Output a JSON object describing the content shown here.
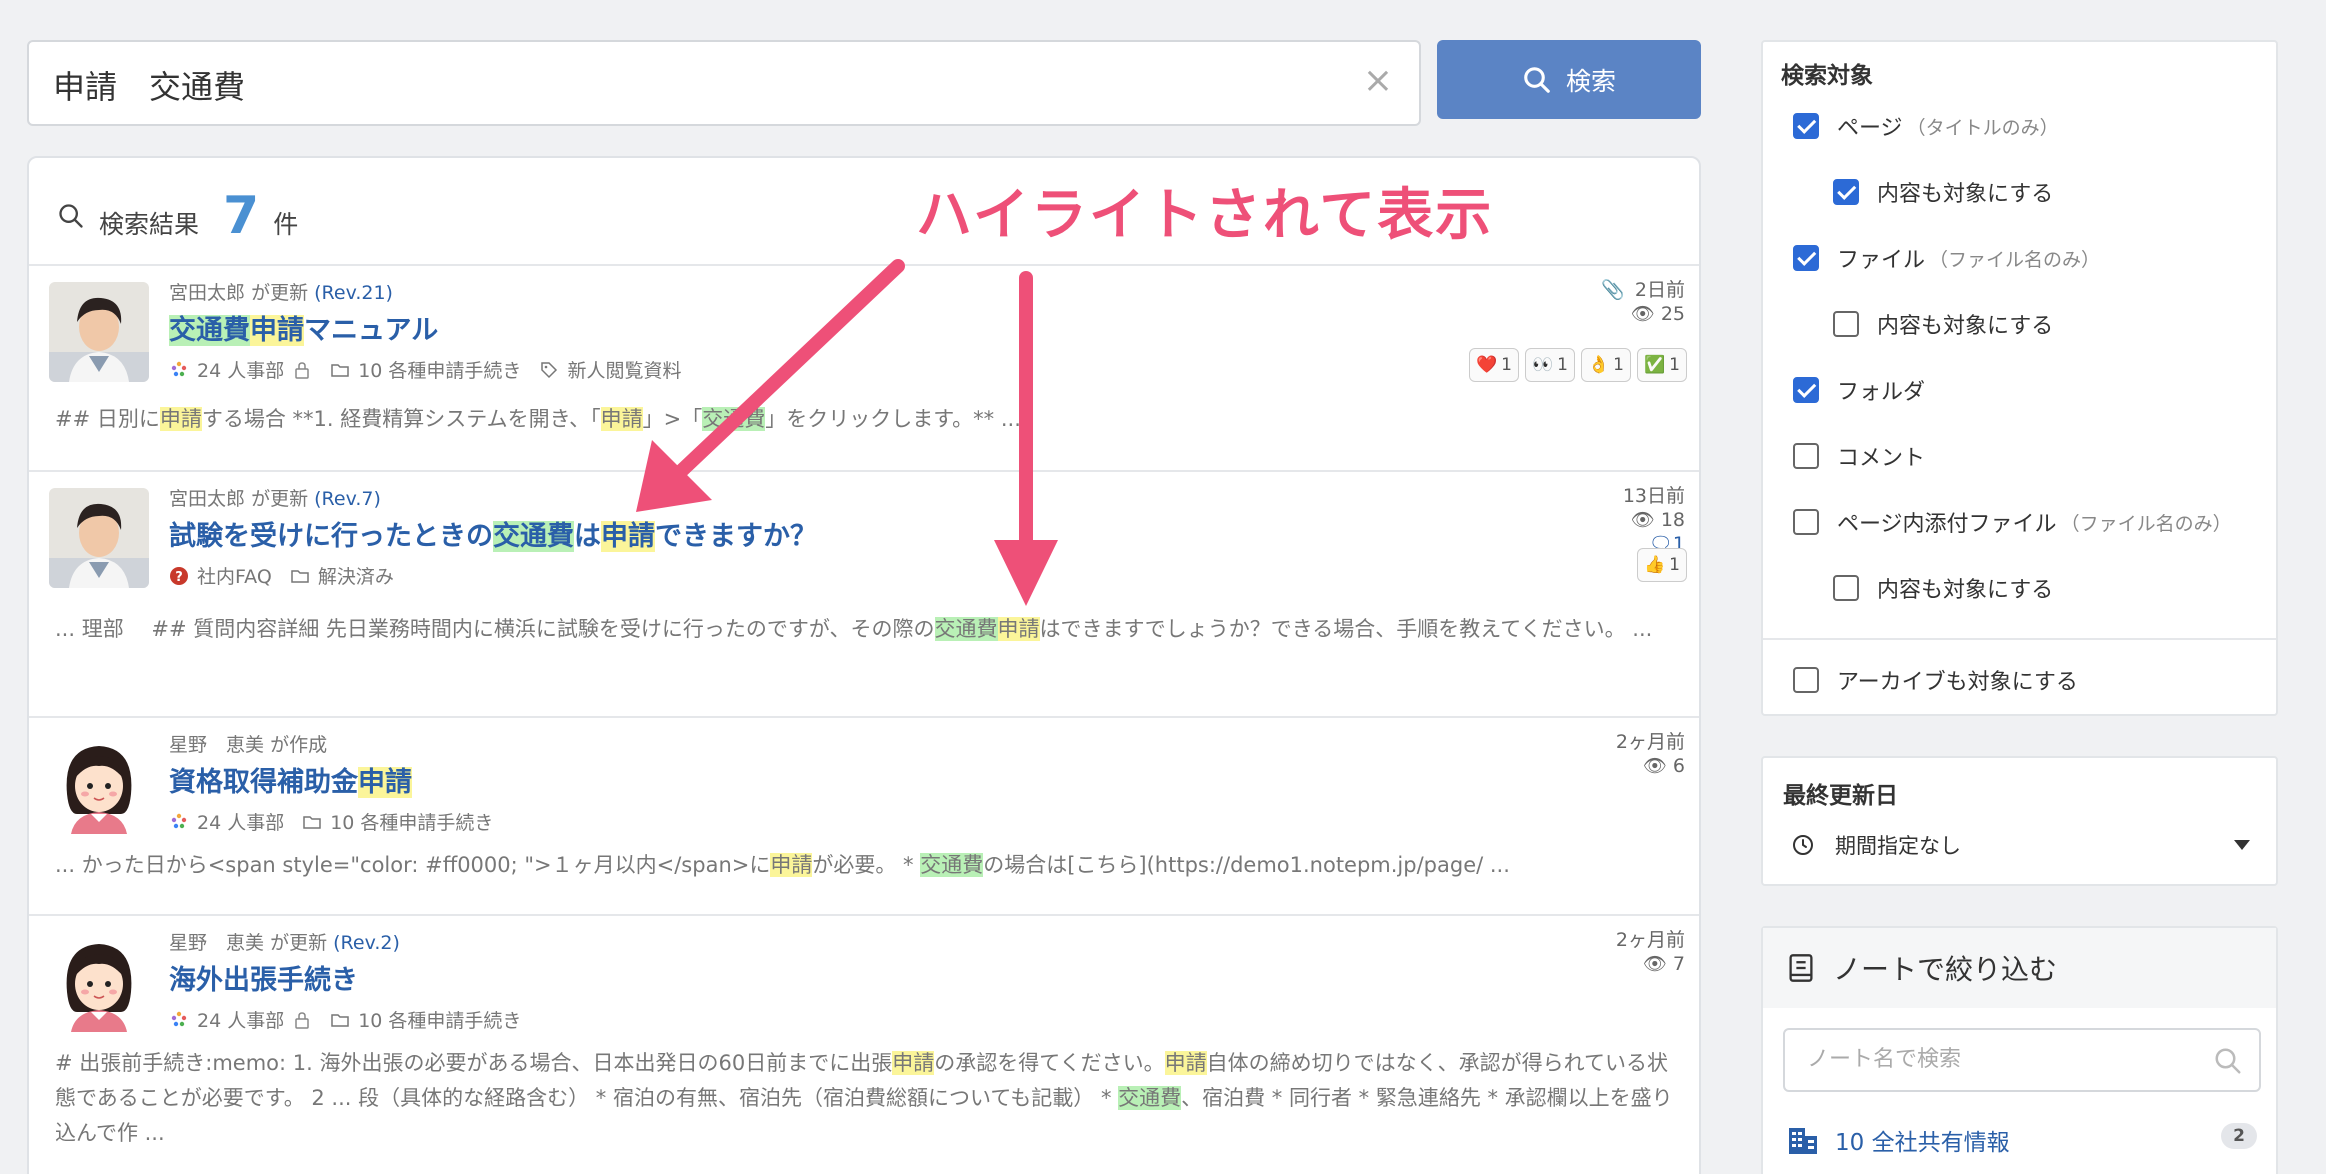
{
  "search": {
    "query": "申請　交通費",
    "clear_symbol": "×",
    "button_label": "検索"
  },
  "results_header": {
    "label": "検索結果",
    "count": "7",
    "unit": "件"
  },
  "annotation": "ハイライトされて表示",
  "colors": {
    "accent": "#5b84c5",
    "link": "#2a5fa8",
    "highlight_yellow": "#fbf59a",
    "highlight_green": "#b9f0b6",
    "annotation": "#ee5078"
  },
  "results": [
    {
      "author": "宮田太郎",
      "action": "が更新",
      "rev": "(Rev.21)",
      "title": [
        {
          "t": "交通費",
          "h": "g"
        },
        {
          "t": "申請",
          "h": "y"
        },
        {
          "t": "マニュアル",
          "h": ""
        }
      ],
      "note": "24 人事部",
      "folder": "10 各種申請手続き",
      "tag": "新人閲覧資料",
      "date": "2日前",
      "views": "25",
      "reactions": [
        {
          "e": "❤️",
          "n": "1"
        },
        {
          "e": "👀",
          "n": "1"
        },
        {
          "e": "👌",
          "n": "1"
        },
        {
          "e": "✅",
          "n": "1"
        }
      ],
      "excerpt": [
        {
          "t": "## 日別に",
          "h": ""
        },
        {
          "t": "申請",
          "h": "y"
        },
        {
          "t": "する場合 **1. 経費精算システムを開き、「",
          "h": ""
        },
        {
          "t": "申請",
          "h": "y"
        },
        {
          "t": "」>「",
          "h": ""
        },
        {
          "t": "交通費",
          "h": "g"
        },
        {
          "t": "」をクリックします。** ...",
          "h": ""
        }
      ]
    },
    {
      "author": "宮田太郎",
      "action": "が更新",
      "rev": "(Rev.7)",
      "title": [
        {
          "t": "試験を受けに行ったときの",
          "h": ""
        },
        {
          "t": "交通費",
          "h": "g"
        },
        {
          "t": "は",
          "h": ""
        },
        {
          "t": "申請",
          "h": "y"
        },
        {
          "t": "できますか？",
          "h": ""
        }
      ],
      "note": "社内FAQ",
      "folder": "解決済み",
      "date": "13日前",
      "views": "18",
      "comments": "1",
      "reactions": [
        {
          "e": "👍",
          "n": "1"
        }
      ],
      "excerpt": [
        {
          "t": "... 理部　 ## 質問内容詳細 先日業務時間内に横浜に試験を受けに行ったのですが、その際の",
          "h": ""
        },
        {
          "t": "交通費",
          "h": "g"
        },
        {
          "t": "申請",
          "h": "y"
        },
        {
          "t": "はできますでしょうか？できる場合、手順を教えてください。 ...",
          "h": ""
        }
      ]
    },
    {
      "author": "星野　恵美",
      "action": "が作成",
      "title": [
        {
          "t": "資格取得補助金",
          "h": ""
        },
        {
          "t": "申請",
          "h": "y"
        }
      ],
      "note": "24 人事部",
      "folder": "10 各種申請手続き",
      "date": "2ヶ月前",
      "views": "6",
      "excerpt": [
        {
          "t": "... かった日から<span style=\"color: #ff0000; \">１ヶ月以内</span>に",
          "h": ""
        },
        {
          "t": "申請",
          "h": "y"
        },
        {
          "t": "が必要。 * ",
          "h": ""
        },
        {
          "t": "交通費",
          "h": "g"
        },
        {
          "t": "の場合は[こちら](https://demo1.notepm.jp/page/ ...",
          "h": ""
        }
      ]
    },
    {
      "author": "星野　恵美",
      "action": "が更新",
      "rev": "(Rev.2)",
      "title": [
        {
          "t": "海外出張手続き",
          "h": ""
        }
      ],
      "note": "24 人事部",
      "folder": "10 各種申請手続き",
      "date": "2ヶ月前",
      "views": "7",
      "excerpt": [
        {
          "t": "# 出張前手続き:memo: 1. 海外出張の必要がある場合、日本出発日の60日前までに出張",
          "h": ""
        },
        {
          "t": "申請",
          "h": "y"
        },
        {
          "t": "の承認を得てください。",
          "h": ""
        },
        {
          "t": "申請",
          "h": "y"
        },
        {
          "t": "自体の締め切りではなく、承認が得られている状態であることが必要です。 2 ... 段（具体的な経路含む） * 宿泊の有無、宿泊先（宿泊費総額についても記載） * ",
          "h": ""
        },
        {
          "t": "交通費",
          "h": "g"
        },
        {
          "t": "、宿泊費 * 同行者 * 緊急連絡先 * 承認欄以上を盛り込んで作 ...",
          "h": ""
        }
      ]
    }
  ],
  "filter": {
    "title": "検索対象",
    "options": [
      {
        "label": "ページ",
        "sub": "（タイトルのみ）",
        "checked": true,
        "indent": false
      },
      {
        "label": "内容も対象にする",
        "sub": "",
        "checked": true,
        "indent": true
      },
      {
        "label": "ファイル",
        "sub": "（ファイル名のみ）",
        "checked": true,
        "indent": false
      },
      {
        "label": "内容も対象にする",
        "sub": "",
        "checked": false,
        "indent": true
      },
      {
        "label": "フォルダ",
        "sub": "",
        "checked": true,
        "indent": false
      },
      {
        "label": "コメント",
        "sub": "",
        "checked": false,
        "indent": false
      },
      {
        "label": "ページ内添付ファイル",
        "sub": "（ファイル名のみ）",
        "checked": false,
        "indent": false
      },
      {
        "label": "内容も対象にする",
        "sub": "",
        "checked": false,
        "indent": true
      }
    ],
    "archive": {
      "label": "アーカイブも対象にする",
      "checked": false
    }
  },
  "date_filter": {
    "title": "最終更新日",
    "value": "期間指定なし"
  },
  "note_filter": {
    "title": "ノートで絞り込む",
    "placeholder": "ノート名で検索",
    "items": [
      {
        "label": "10 全社共有情報",
        "count": "2"
      }
    ]
  }
}
